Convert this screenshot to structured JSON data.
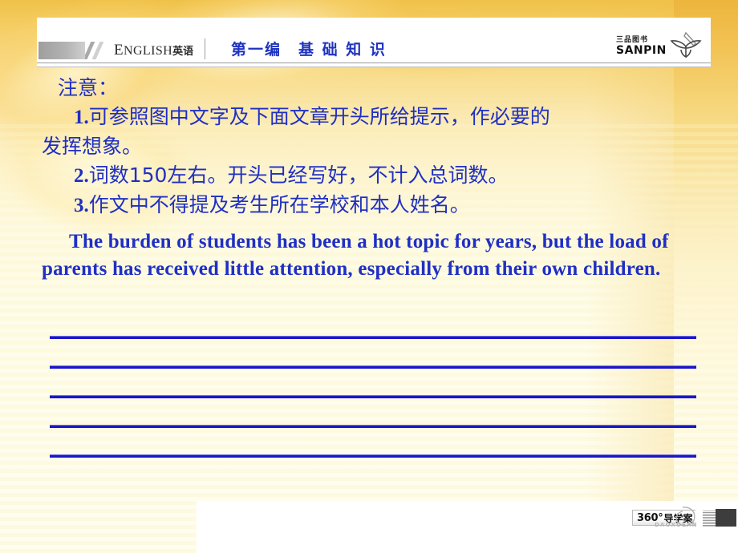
{
  "slide": {
    "background_top_color": "#f0c24a",
    "background_bottom_color": "#fffdef",
    "text_color": "#1f2fc4"
  },
  "header": {
    "brand_cap": "E",
    "brand_rest": "NGLISH",
    "brand_cjk": "英语",
    "title": "第一编　基 础 知 识",
    "title_color": "#1f33c0",
    "publisher_logo": {
      "cn": "三品图书",
      "en": "SANPIN",
      "icon": "lotus-leaf-mark"
    }
  },
  "body": {
    "heading": "注意：",
    "items": [
      {
        "number": "1.",
        "text_line1": "可参照图中文字及下面文章开头所给提示，作必要的",
        "text_line2": "发挥想象。"
      },
      {
        "number": "2.",
        "text_line1": "词数150左右。开头已经写好，不计入总词数。",
        "text_line2": ""
      },
      {
        "number": "3.",
        "text_line1": "作文中不得提及考生所在学校和本人姓名。",
        "text_line2": ""
      }
    ],
    "english_paragraph": "The burden of students has been a hot topic for years, but the load of parents has received little attention, especially from their own children."
  },
  "writing_lines": {
    "count": 5,
    "color": "#1a16c8",
    "tops": [
      419,
      456,
      493,
      530,
      567
    ]
  },
  "footer": {
    "logo": {
      "degrees": "360°",
      "cn": "导学案",
      "pinyin": "DAOXUEAN"
    }
  }
}
